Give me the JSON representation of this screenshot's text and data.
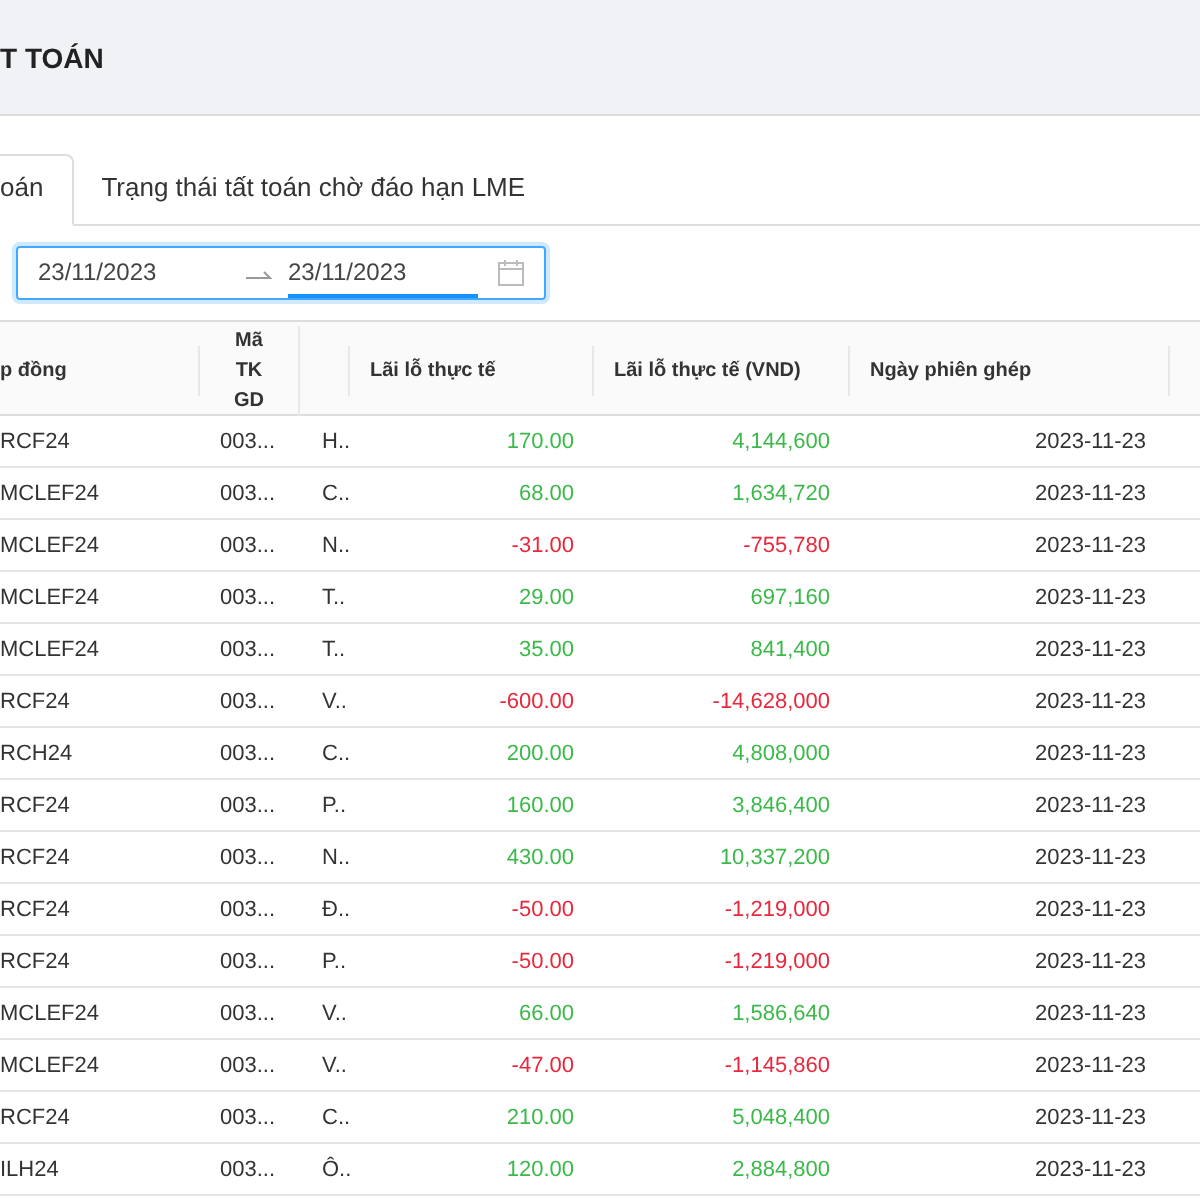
{
  "header": {
    "title": "T TOÁN"
  },
  "tabs": [
    {
      "label": "oán",
      "selected": true
    },
    {
      "label": "Trạng thái tất toán chờ đáo hạn LME",
      "selected": false
    }
  ],
  "date_range": {
    "focused": true,
    "start": {
      "value": "23/11/2023",
      "active": false
    },
    "end": {
      "value": "23/11/2023",
      "active": true
    }
  },
  "table": {
    "columns": [
      "p đồng",
      "Mã TK GD",
      "",
      "Lãi lỗ thực tế",
      "Lãi lỗ thực tế (VND)",
      "Ngày phiên ghép"
    ],
    "rows": [
      {
        "contract": "RCF24",
        "account": "003...",
        "column_3": "H..",
        "pnl": "170.00",
        "pnl_vnd": "4,144,600",
        "date": "2023-11-23",
        "color": "#3cb94a"
      },
      {
        "contract": "MCLEF24",
        "account": "003...",
        "column_3": "C..",
        "pnl": "68.00",
        "pnl_vnd": "1,634,720",
        "date": "2023-11-23",
        "color": "#3cb94a"
      },
      {
        "contract": "MCLEF24",
        "account": "003...",
        "column_3": "N..",
        "pnl": "-31.00",
        "pnl_vnd": "-755,780",
        "date": "2023-11-23",
        "color": "#e8283c"
      },
      {
        "contract": "MCLEF24",
        "account": "003...",
        "column_3": "T..",
        "pnl": "29.00",
        "pnl_vnd": "697,160",
        "date": "2023-11-23",
        "color": "#3cb94a"
      },
      {
        "contract": "MCLEF24",
        "account": "003...",
        "column_3": "T..",
        "pnl": "35.00",
        "pnl_vnd": "841,400",
        "date": "2023-11-23",
        "color": "#3cb94a"
      },
      {
        "contract": "RCF24",
        "account": "003...",
        "column_3": "V..",
        "pnl": "-600.00",
        "pnl_vnd": "-14,628,000",
        "date": "2023-11-23",
        "color": "#e8283c"
      },
      {
        "contract": "RCH24",
        "account": "003...",
        "column_3": "C..",
        "pnl": "200.00",
        "pnl_vnd": "4,808,000",
        "date": "2023-11-23",
        "color": "#3cb94a"
      },
      {
        "contract": "RCF24",
        "account": "003...",
        "column_3": "P..",
        "pnl": "160.00",
        "pnl_vnd": "3,846,400",
        "date": "2023-11-23",
        "color": "#3cb94a"
      },
      {
        "contract": "RCF24",
        "account": "003...",
        "column_3": "N..",
        "pnl": "430.00",
        "pnl_vnd": "10,337,200",
        "date": "2023-11-23",
        "color": "#3cb94a"
      },
      {
        "contract": "RCF24",
        "account": "003...",
        "column_3": "Đ..",
        "pnl": "-50.00",
        "pnl_vnd": "-1,219,000",
        "date": "2023-11-23",
        "color": "#e8283c"
      },
      {
        "contract": "RCF24",
        "account": "003...",
        "column_3": "P..",
        "pnl": "-50.00",
        "pnl_vnd": "-1,219,000",
        "date": "2023-11-23",
        "color": "#e8283c"
      },
      {
        "contract": "MCLEF24",
        "account": "003...",
        "column_3": "V..",
        "pnl": "66.00",
        "pnl_vnd": "1,586,640",
        "date": "2023-11-23",
        "color": "#3cb94a"
      },
      {
        "contract": "MCLEF24",
        "account": "003...",
        "column_3": "V..",
        "pnl": "-47.00",
        "pnl_vnd": "-1,145,860",
        "date": "2023-11-23",
        "color": "#e8283c"
      },
      {
        "contract": "RCF24",
        "account": "003...",
        "column_3": "C..",
        "pnl": "210.00",
        "pnl_vnd": "5,048,400",
        "date": "2023-11-23",
        "color": "#3cb94a"
      },
      {
        "contract": "ILH24",
        "account": "003...",
        "column_3": "Ô..",
        "pnl": "120.00",
        "pnl_vnd": "2,884,800",
        "date": "2023-11-23",
        "color": "#3cb94a"
      }
    ]
  }
}
